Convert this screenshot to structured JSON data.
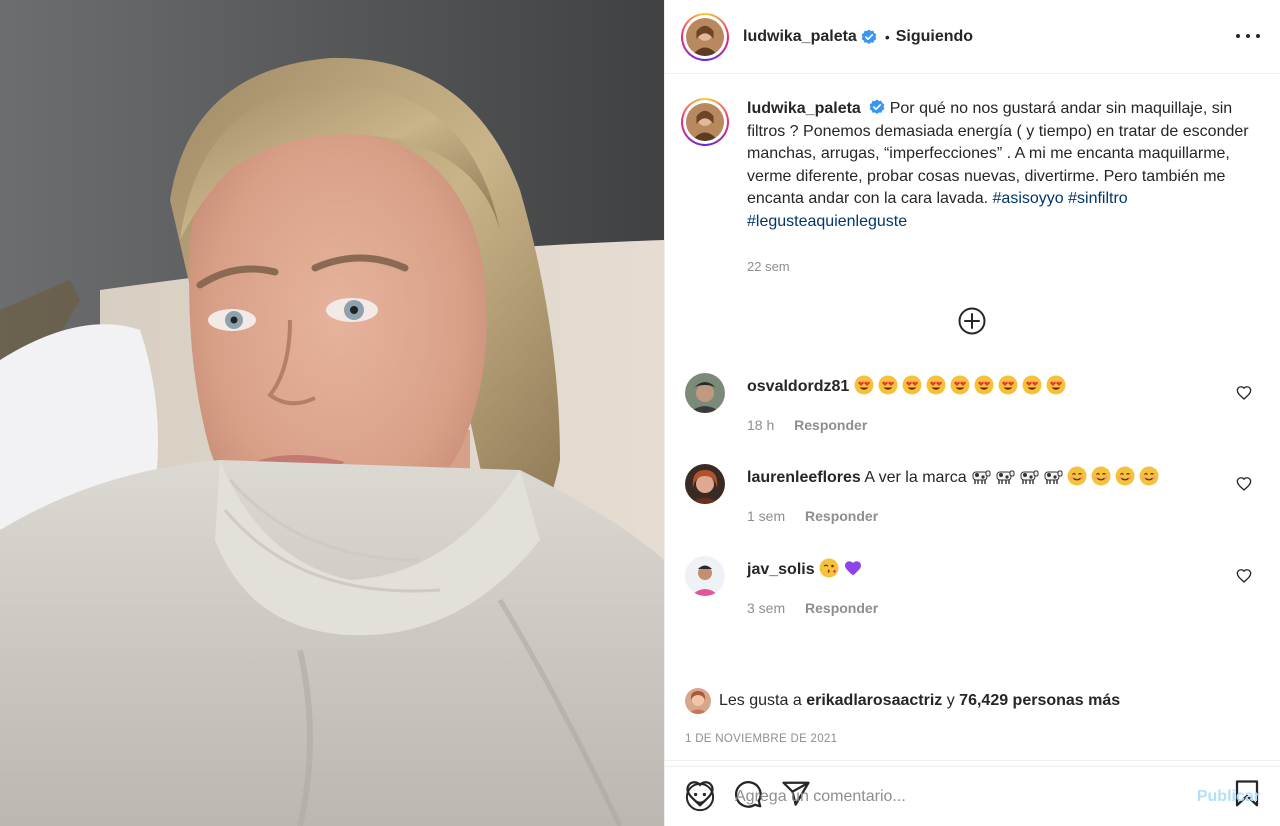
{
  "post": {
    "author": "ludwika_paleta",
    "follow_separator": "•",
    "follow_status": "Siguiendo",
    "caption_text": "Por qué no nos gustará andar sin maquillaje, sin filtros ? Ponemos demasiada energía ( y tiempo) en tratar de esconder manchas, arrugas, “imperfecciones” . A mi me encanta maquillarme, verme diferente, probar cosas nuevas, divertirme. Pero también me encanta andar con la cara lavada.",
    "hashtags": [
      "#asisoyyo",
      "#sinfiltro",
      "#legusteaquienleguste"
    ],
    "caption_time": "22 sem"
  },
  "comments": [
    {
      "user": "osvaldordz81",
      "text": "",
      "emojis": [
        "heart-eyes",
        "heart-eyes",
        "heart-eyes",
        "heart-eyes",
        "heart-eyes",
        "heart-eyes",
        "heart-eyes",
        "heart-eyes",
        "heart-eyes"
      ],
      "time": "18 h",
      "reply_label": "Responder"
    },
    {
      "user": "laurenleeflores",
      "text": "A ver la marca",
      "emojis": [
        "cow",
        "cow",
        "cow",
        "cow",
        "smile",
        "smile",
        "smile",
        "smile"
      ],
      "time": "1 sem",
      "reply_label": "Responder"
    },
    {
      "user": "jav_solis",
      "text": "",
      "emojis": [
        "kiss-wink",
        "purple-heart"
      ],
      "time": "3 sem",
      "reply_label": "Responder"
    }
  ],
  "likes": {
    "prefix": "Les gusta a",
    "user": "erikadlarosaactriz",
    "joiner": "y",
    "count_text": "76,429 personas más"
  },
  "date": "1 DE NOVIEMBRE DE 2021",
  "comment_box": {
    "placeholder": "Agrega un comentario...",
    "publish_label": "Publicar"
  },
  "colors": {
    "link": "#00376b",
    "muted": "#8e8e8e",
    "publish_disabled": "#b2dffc",
    "verified": "#3897f0"
  }
}
